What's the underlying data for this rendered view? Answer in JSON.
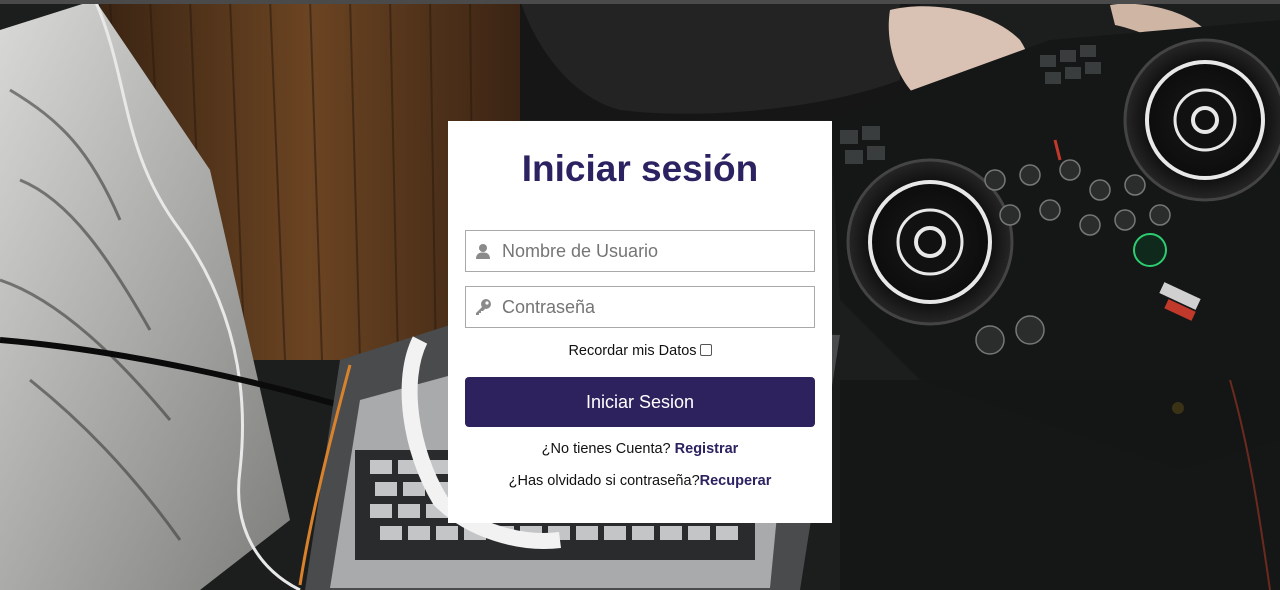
{
  "login": {
    "title": "Iniciar sesión",
    "username_placeholder": "Nombre de Usuario",
    "password_placeholder": "Contraseña",
    "remember_label": "Recordar mis Datos",
    "remember_checked": false,
    "submit_label": "Iniciar Sesion",
    "register_prompt": "¿No tienes Cuenta? ",
    "register_link": "Registrar",
    "recover_prompt": "¿Has olvidado si contraseña?",
    "recover_link": "Recuperar"
  },
  "icons": {
    "username": "user-icon",
    "password": "key-icon"
  },
  "colors": {
    "title": "#2b2261",
    "button": "#2d225e",
    "link": "#2b2261",
    "card": "#ffffff"
  }
}
